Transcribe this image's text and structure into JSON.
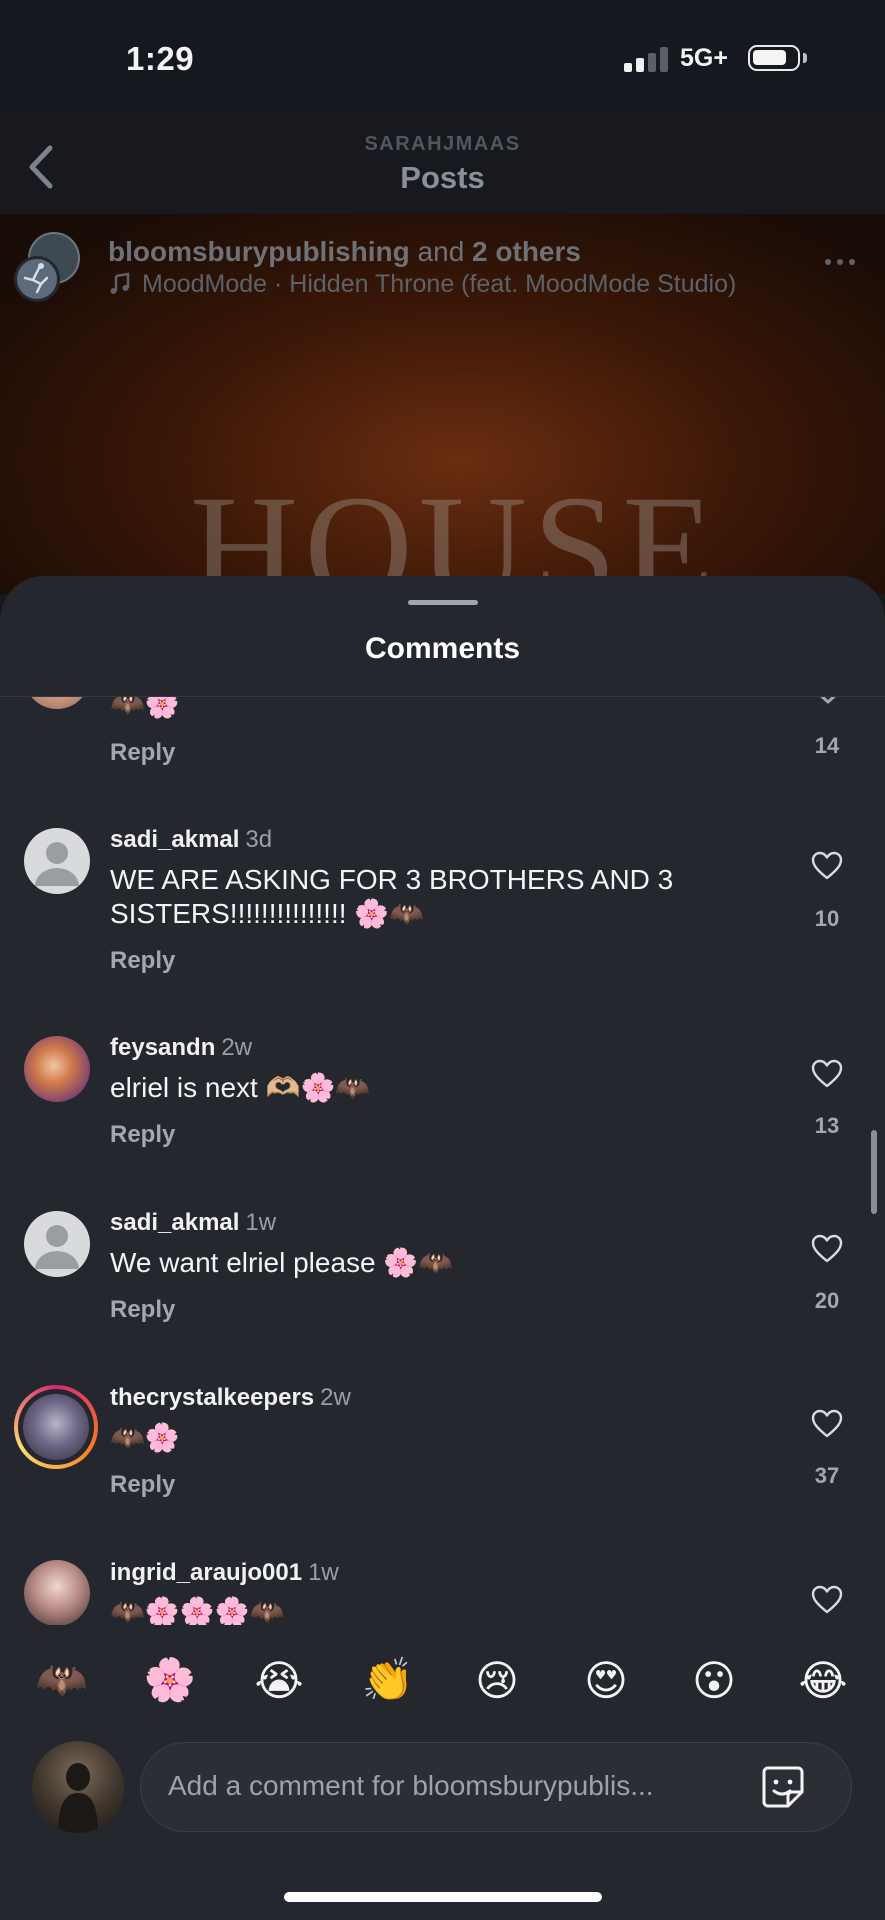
{
  "status_bar": {
    "time": "1:29",
    "network": "5G+"
  },
  "header": {
    "account": "SARAHJMAAS",
    "title": "Posts"
  },
  "post": {
    "author": "bloomsburypublishing",
    "and_text": "and",
    "others": "2 others",
    "song": "MoodMode · Hidden Throne (feat. MoodMode Studio)",
    "image_text": "HOUSE"
  },
  "sheet": {
    "title": "Comments"
  },
  "comments": [
    {
      "username": "",
      "time": "",
      "text": "🦇🌸",
      "reply": "Reply",
      "likes": "14"
    },
    {
      "username": "sadi_akmal",
      "time": "3d",
      "text": "WE ARE ASKING FOR 3 BROTHERS AND 3 SISTERS!!!!!!!!!!!!!!! 🌸🦇",
      "reply": "Reply",
      "likes": "10"
    },
    {
      "username": "feysandn",
      "time": "2w",
      "text": "elriel is next 🫶🏼🌸🦇",
      "reply": "Reply",
      "likes": "13"
    },
    {
      "username": "sadi_akmal",
      "time": "1w",
      "text": "We want elriel please 🌸🦇",
      "reply": "Reply",
      "likes": "20"
    },
    {
      "username": "thecrystalkeepers",
      "time": "2w",
      "text": "🦇🌸",
      "reply": "Reply",
      "likes": "37"
    },
    {
      "username": "ingrid_araujo001",
      "time": "1w",
      "text": "🦇🌸🌸🌸🦇",
      "reply": "Reply",
      "likes": ""
    }
  ],
  "emoji_bar": [
    "🦇",
    "🌸",
    "😭",
    "👏",
    "😢",
    "😍",
    "😮",
    "😂"
  ],
  "composer": {
    "placeholder": "Add a comment for bloomsburypublis..."
  },
  "colors": {
    "sheet_bg": "#24272d",
    "text_primary": "#f4f4f5",
    "text_secondary": "#a3a7ae",
    "story_ring": "#d62976"
  }
}
